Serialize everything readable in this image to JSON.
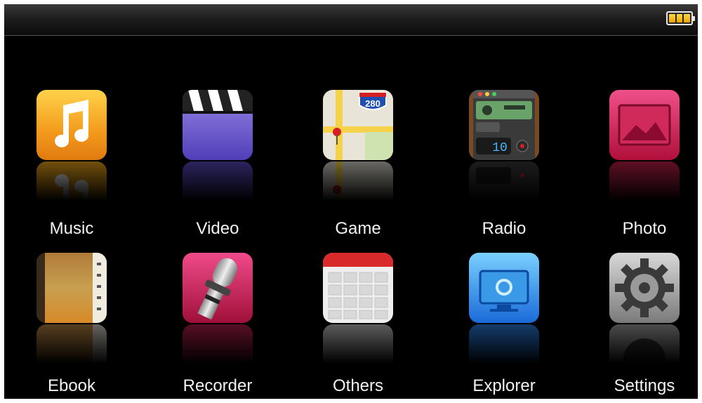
{
  "status_bar": {
    "battery_icon": "battery-full-icon",
    "battery_color": "#f5b800"
  },
  "apps": [
    {
      "label": "Music",
      "icon": "music-note-icon"
    },
    {
      "label": "Video",
      "icon": "clapperboard-icon"
    },
    {
      "label": "Game",
      "icon": "map-icon"
    },
    {
      "label": "Radio",
      "icon": "radio-icon"
    },
    {
      "label": "Photo",
      "icon": "photo-icon"
    },
    {
      "label": "Ebook",
      "icon": "book-icon"
    },
    {
      "label": "Recorder",
      "icon": "microphone-icon"
    },
    {
      "label": "Others",
      "icon": "calendar-icon"
    },
    {
      "label": "Explorer",
      "icon": "monitor-icon"
    },
    {
      "label": "Settings",
      "icon": "gear-icon"
    }
  ],
  "map_sign_text": "280",
  "radio_display_text": "10"
}
